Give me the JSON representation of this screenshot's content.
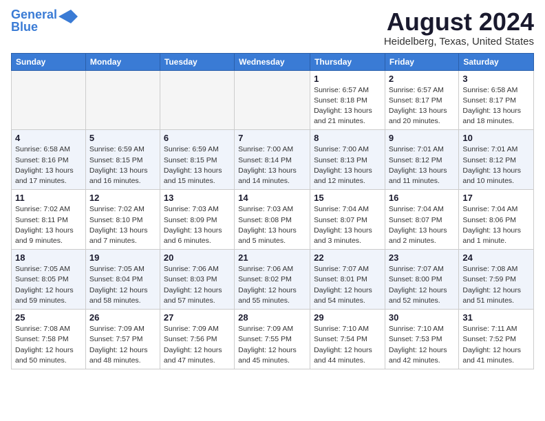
{
  "logo": {
    "line1": "General",
    "line2": "Blue"
  },
  "title": "August 2024",
  "subtitle": "Heidelberg, Texas, United States",
  "days_of_week": [
    "Sunday",
    "Monday",
    "Tuesday",
    "Wednesday",
    "Thursday",
    "Friday",
    "Saturday"
  ],
  "weeks": [
    [
      {
        "day": "",
        "info": ""
      },
      {
        "day": "",
        "info": ""
      },
      {
        "day": "",
        "info": ""
      },
      {
        "day": "",
        "info": ""
      },
      {
        "day": "1",
        "info": "Sunrise: 6:57 AM\nSunset: 8:18 PM\nDaylight: 13 hours\nand 21 minutes."
      },
      {
        "day": "2",
        "info": "Sunrise: 6:57 AM\nSunset: 8:17 PM\nDaylight: 13 hours\nand 20 minutes."
      },
      {
        "day": "3",
        "info": "Sunrise: 6:58 AM\nSunset: 8:17 PM\nDaylight: 13 hours\nand 18 minutes."
      }
    ],
    [
      {
        "day": "4",
        "info": "Sunrise: 6:58 AM\nSunset: 8:16 PM\nDaylight: 13 hours\nand 17 minutes."
      },
      {
        "day": "5",
        "info": "Sunrise: 6:59 AM\nSunset: 8:15 PM\nDaylight: 13 hours\nand 16 minutes."
      },
      {
        "day": "6",
        "info": "Sunrise: 6:59 AM\nSunset: 8:15 PM\nDaylight: 13 hours\nand 15 minutes."
      },
      {
        "day": "7",
        "info": "Sunrise: 7:00 AM\nSunset: 8:14 PM\nDaylight: 13 hours\nand 14 minutes."
      },
      {
        "day": "8",
        "info": "Sunrise: 7:00 AM\nSunset: 8:13 PM\nDaylight: 13 hours\nand 12 minutes."
      },
      {
        "day": "9",
        "info": "Sunrise: 7:01 AM\nSunset: 8:12 PM\nDaylight: 13 hours\nand 11 minutes."
      },
      {
        "day": "10",
        "info": "Sunrise: 7:01 AM\nSunset: 8:12 PM\nDaylight: 13 hours\nand 10 minutes."
      }
    ],
    [
      {
        "day": "11",
        "info": "Sunrise: 7:02 AM\nSunset: 8:11 PM\nDaylight: 13 hours\nand 9 minutes."
      },
      {
        "day": "12",
        "info": "Sunrise: 7:02 AM\nSunset: 8:10 PM\nDaylight: 13 hours\nand 7 minutes."
      },
      {
        "day": "13",
        "info": "Sunrise: 7:03 AM\nSunset: 8:09 PM\nDaylight: 13 hours\nand 6 minutes."
      },
      {
        "day": "14",
        "info": "Sunrise: 7:03 AM\nSunset: 8:08 PM\nDaylight: 13 hours\nand 5 minutes."
      },
      {
        "day": "15",
        "info": "Sunrise: 7:04 AM\nSunset: 8:07 PM\nDaylight: 13 hours\nand 3 minutes."
      },
      {
        "day": "16",
        "info": "Sunrise: 7:04 AM\nSunset: 8:07 PM\nDaylight: 13 hours\nand 2 minutes."
      },
      {
        "day": "17",
        "info": "Sunrise: 7:04 AM\nSunset: 8:06 PM\nDaylight: 13 hours\nand 1 minute."
      }
    ],
    [
      {
        "day": "18",
        "info": "Sunrise: 7:05 AM\nSunset: 8:05 PM\nDaylight: 12 hours\nand 59 minutes."
      },
      {
        "day": "19",
        "info": "Sunrise: 7:05 AM\nSunset: 8:04 PM\nDaylight: 12 hours\nand 58 minutes."
      },
      {
        "day": "20",
        "info": "Sunrise: 7:06 AM\nSunset: 8:03 PM\nDaylight: 12 hours\nand 57 minutes."
      },
      {
        "day": "21",
        "info": "Sunrise: 7:06 AM\nSunset: 8:02 PM\nDaylight: 12 hours\nand 55 minutes."
      },
      {
        "day": "22",
        "info": "Sunrise: 7:07 AM\nSunset: 8:01 PM\nDaylight: 12 hours\nand 54 minutes."
      },
      {
        "day": "23",
        "info": "Sunrise: 7:07 AM\nSunset: 8:00 PM\nDaylight: 12 hours\nand 52 minutes."
      },
      {
        "day": "24",
        "info": "Sunrise: 7:08 AM\nSunset: 7:59 PM\nDaylight: 12 hours\nand 51 minutes."
      }
    ],
    [
      {
        "day": "25",
        "info": "Sunrise: 7:08 AM\nSunset: 7:58 PM\nDaylight: 12 hours\nand 50 minutes."
      },
      {
        "day": "26",
        "info": "Sunrise: 7:09 AM\nSunset: 7:57 PM\nDaylight: 12 hours\nand 48 minutes."
      },
      {
        "day": "27",
        "info": "Sunrise: 7:09 AM\nSunset: 7:56 PM\nDaylight: 12 hours\nand 47 minutes."
      },
      {
        "day": "28",
        "info": "Sunrise: 7:09 AM\nSunset: 7:55 PM\nDaylight: 12 hours\nand 45 minutes."
      },
      {
        "day": "29",
        "info": "Sunrise: 7:10 AM\nSunset: 7:54 PM\nDaylight: 12 hours\nand 44 minutes."
      },
      {
        "day": "30",
        "info": "Sunrise: 7:10 AM\nSunset: 7:53 PM\nDaylight: 12 hours\nand 42 minutes."
      },
      {
        "day": "31",
        "info": "Sunrise: 7:11 AM\nSunset: 7:52 PM\nDaylight: 12 hours\nand 41 minutes."
      }
    ]
  ]
}
